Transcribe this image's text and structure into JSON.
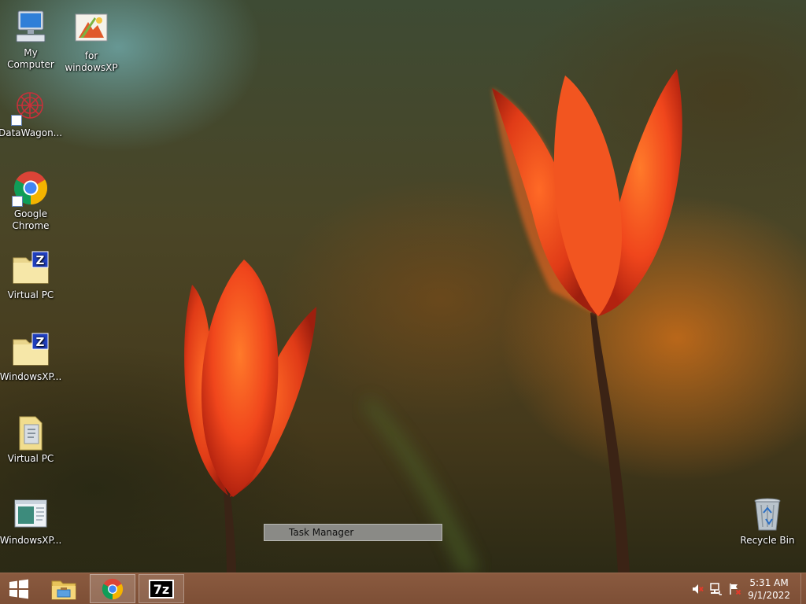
{
  "desktop": {
    "icons": [
      {
        "label": "My Computer",
        "icon": "computer-icon"
      },
      {
        "label": "for windowsXP",
        "icon": "image-file-icon"
      },
      {
        "label": "DataWagon...",
        "icon": "datawagon-icon"
      },
      {
        "label": "Google Chrome",
        "icon": "chrome-icon"
      },
      {
        "label": "Virtual PC",
        "icon": "zipped-folder-icon"
      },
      {
        "label": "WindowsXP...",
        "icon": "zipped-folder-icon"
      },
      {
        "label": "Virtual PC",
        "icon": "folder-icon"
      },
      {
        "label": "WindowsXP...",
        "icon": "window-app-icon"
      },
      {
        "label": "Recycle Bin",
        "icon": "recycle-bin-icon"
      }
    ]
  },
  "tooltip": {
    "text": "Task Manager"
  },
  "taskbar": {
    "start": {
      "icon": "windows-logo-icon"
    },
    "pinned": [
      {
        "name": "File Explorer",
        "icon": "file-explorer-icon"
      },
      {
        "name": "Google Chrome",
        "icon": "chrome-icon"
      },
      {
        "name": "7-Zip",
        "icon": "7zip-icon",
        "glyph": "7z"
      }
    ],
    "tray": {
      "icons": [
        "speaker-muted-icon",
        "network-icon",
        "action-center-flag-icon"
      ],
      "time": "5:31 AM",
      "date": "9/1/2022"
    }
  },
  "colors": {
    "taskbar": "#7d4f36",
    "tulip": "#e8451c",
    "tooltip_bg": "#8a8a86"
  }
}
